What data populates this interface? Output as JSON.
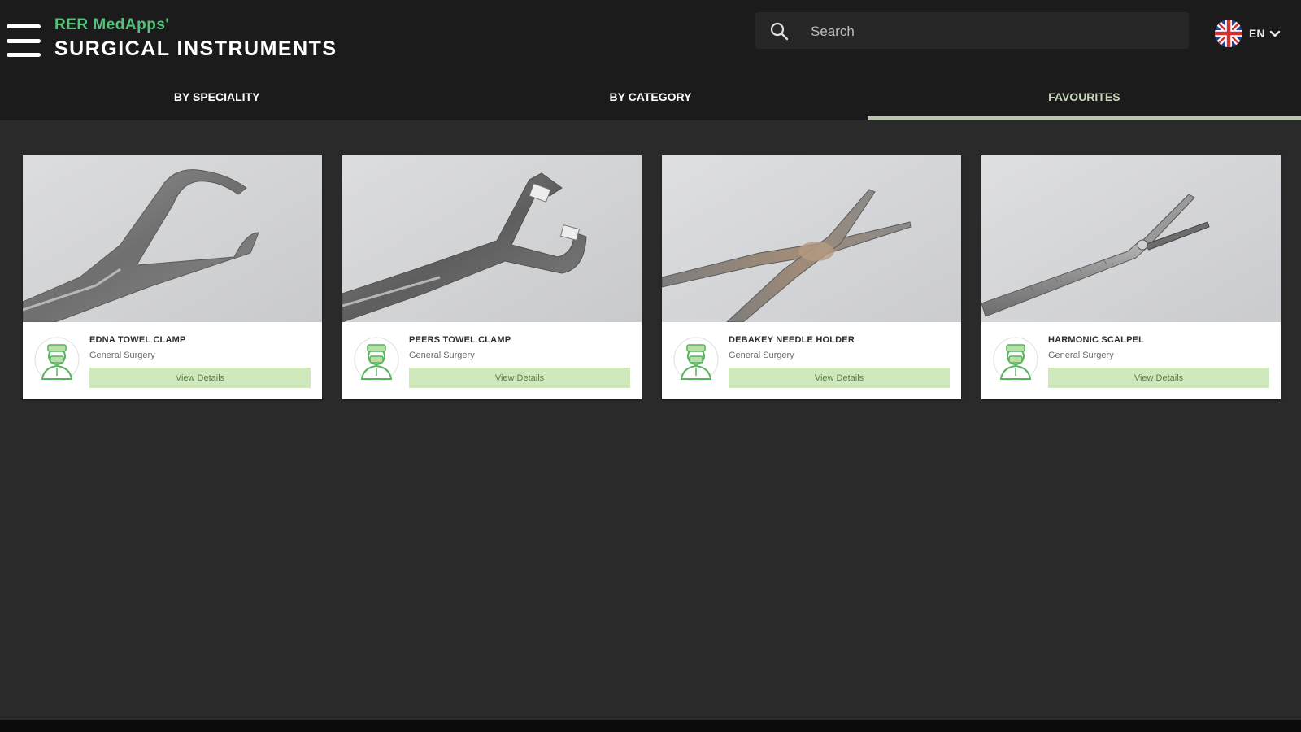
{
  "header": {
    "brand_sub": "RER MedApps'",
    "brand_title": "SURGICAL INSTRUMENTS",
    "menu_icon": "hamburger-menu-icon",
    "search": {
      "placeholder": "Search",
      "icon": "search-icon"
    },
    "language": {
      "code": "EN",
      "flag_icon": "uk-flag-icon",
      "chevron_icon": "chevron-down-icon"
    }
  },
  "tabs": [
    {
      "label": "BY SPECIALITY",
      "active": false
    },
    {
      "label": "BY CATEGORY",
      "active": false
    },
    {
      "label": "FAVOURITES",
      "active": true
    }
  ],
  "favourites": [
    {
      "name": "EDNA TOWEL CLAMP",
      "category": "General Surgery",
      "button": "View Details"
    },
    {
      "name": "PEERS TOWEL CLAMP",
      "category": "General Surgery",
      "button": "View Details"
    },
    {
      "name": "DEBAKEY NEEDLE HOLDER",
      "category": "General Surgery",
      "button": "View Details"
    },
    {
      "name": "HARMONIC SCALPEL",
      "category": "General Surgery",
      "button": "View Details"
    }
  ],
  "colors": {
    "accent_green": "#55c17a",
    "button_green": "#cfe9bd",
    "header_bg": "#1b1b1c",
    "page_bg": "#2a2a2b"
  }
}
